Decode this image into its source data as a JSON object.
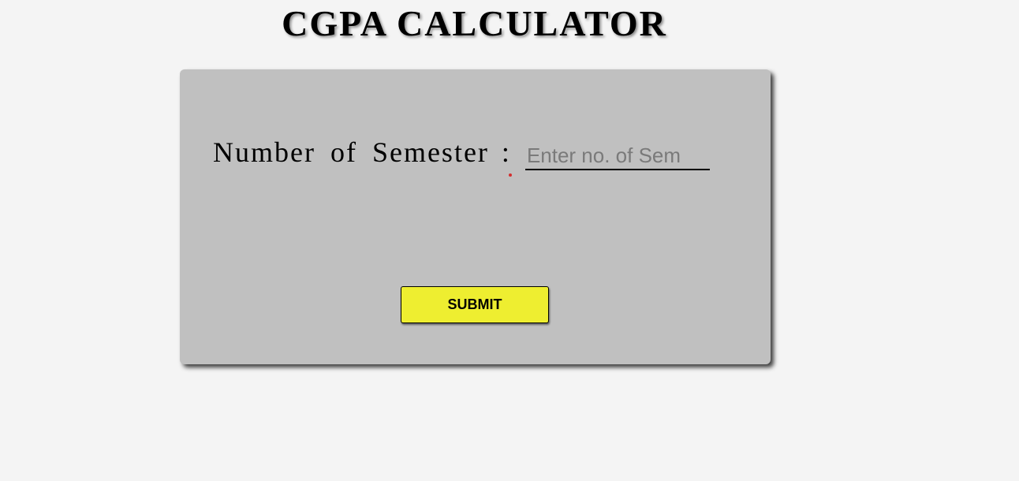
{
  "header": {
    "title": "CGPA CALCULATOR"
  },
  "form": {
    "semester_label": "Number of Semester",
    "colon": ":",
    "semester_placeholder": "Enter no. of Sem",
    "semester_value": "",
    "submit_label": "SUBMIT"
  },
  "colors": {
    "page_background": "#f4f4f4",
    "card_background": "#c0c0c0",
    "submit_button": "#eeee30",
    "marker_dot": "#d32f2f"
  }
}
